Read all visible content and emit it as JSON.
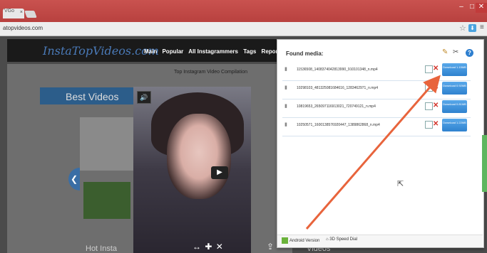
{
  "browser": {
    "tab_label": "VGo",
    "tab_close": "×",
    "url": "atopvideos.com",
    "win_min": "–",
    "win_max": "□",
    "win_close": "✕",
    "star_icon": "☆",
    "extension_icon": "download",
    "menu_icon": "≡"
  },
  "site": {
    "logo": "InstaTopVideos.com",
    "nav": [
      "Main",
      "Popular",
      "All Instagrammers",
      "Tags",
      "Report"
    ],
    "subheading": "Top Instagram Video Compilation",
    "best_videos": "Best Videos",
    "hot_left": "Hot Insta",
    "hot_right": "Videos"
  },
  "video": {
    "speaker_icon": "speaker",
    "play_icon": "▶",
    "controls": "↔ ✚ ✕",
    "share_icon": "share"
  },
  "popup": {
    "title": "Found media:",
    "items": [
      {
        "name": "11536508_1408374042813990_910101348_n.mp4",
        "button": "Download 1.15MB"
      },
      {
        "name": "10298103_481325081684616_1283462971_n.mp4",
        "button": "Download 0.92MB"
      },
      {
        "name": "10819653_265097116913021_720749121_n.mp4",
        "button": "Download 0.81MB"
      },
      {
        "name": "10250571_1600138576920447_1389862868_n.mp4",
        "button": "Download 1.22MB"
      }
    ],
    "footer_android": "Android Version",
    "footer_speed": "3D Speed Dial"
  },
  "colors": {
    "titlebar": "#b8413f",
    "download_button": "#2f82cf",
    "delete": "#d3342b",
    "annotation_arrow": "#e8643c"
  }
}
